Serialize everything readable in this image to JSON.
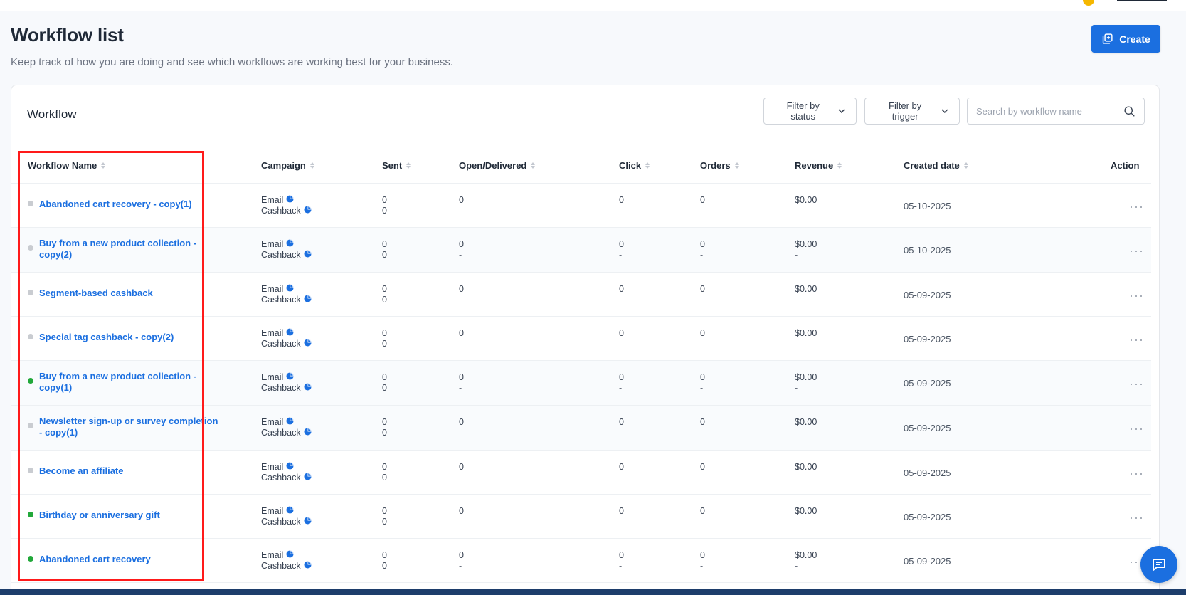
{
  "page": {
    "title": "Workflow list",
    "subtitle": "Keep track of how you are doing and see which workflows are working best for your business.",
    "create_label": "Create"
  },
  "card": {
    "title": "Workflow",
    "filter_status_label": "Filter by status",
    "filter_trigger_label": "Filter by trigger",
    "search_placeholder": "Search by workflow name"
  },
  "table": {
    "columns": [
      "Workflow Name",
      "Campaign",
      "Sent",
      "Open/Delivered",
      "Click",
      "Orders",
      "Revenue",
      "Created date",
      "Action"
    ],
    "campaign_email": "Email",
    "campaign_cashback": "Cashback",
    "rows": [
      {
        "name": "Abandoned cart recovery - copy(1)",
        "status": "inactive",
        "sent": [
          "0",
          "0"
        ],
        "open": [
          "0",
          "-"
        ],
        "click": [
          "0",
          "-"
        ],
        "orders": [
          "0",
          "-"
        ],
        "revenue": [
          "$0.00",
          "-"
        ],
        "created": "05-10-2025",
        "action": "···"
      },
      {
        "name": "Buy from a new product collection - copy(2)",
        "status": "inactive",
        "sent": [
          "0",
          "0"
        ],
        "open": [
          "0",
          "-"
        ],
        "click": [
          "0",
          "-"
        ],
        "orders": [
          "0",
          "-"
        ],
        "revenue": [
          "$0.00",
          "-"
        ],
        "created": "05-10-2025",
        "action": "···"
      },
      {
        "name": "Segment-based cashback",
        "status": "inactive",
        "sent": [
          "0",
          "0"
        ],
        "open": [
          "0",
          "-"
        ],
        "click": [
          "0",
          "-"
        ],
        "orders": [
          "0",
          "-"
        ],
        "revenue": [
          "$0.00",
          "-"
        ],
        "created": "05-09-2025",
        "action": "···"
      },
      {
        "name": "Special tag cashback - copy(2)",
        "status": "inactive",
        "sent": [
          "0",
          "0"
        ],
        "open": [
          "0",
          "-"
        ],
        "click": [
          "0",
          "-"
        ],
        "orders": [
          "0",
          "-"
        ],
        "revenue": [
          "$0.00",
          "-"
        ],
        "created": "05-09-2025",
        "action": "···"
      },
      {
        "name": "Buy from a new product collection - copy(1)",
        "status": "active",
        "sent": [
          "0",
          "0"
        ],
        "open": [
          "0",
          "-"
        ],
        "click": [
          "0",
          "-"
        ],
        "orders": [
          "0",
          "-"
        ],
        "revenue": [
          "$0.00",
          "-"
        ],
        "created": "05-09-2025",
        "action": "···"
      },
      {
        "name": "Newsletter sign-up or survey completion - copy(1)",
        "status": "inactive",
        "sent": [
          "0",
          "0"
        ],
        "open": [
          "0",
          "-"
        ],
        "click": [
          "0",
          "-"
        ],
        "orders": [
          "0",
          "-"
        ],
        "revenue": [
          "$0.00",
          "-"
        ],
        "created": "05-09-2025",
        "action": "···"
      },
      {
        "name": "Become an affiliate",
        "status": "inactive",
        "sent": [
          "0",
          "0"
        ],
        "open": [
          "0",
          "-"
        ],
        "click": [
          "0",
          "-"
        ],
        "orders": [
          "0",
          "-"
        ],
        "revenue": [
          "$0.00",
          "-"
        ],
        "created": "05-09-2025",
        "action": "···"
      },
      {
        "name": "Birthday or anniversary gift",
        "status": "active",
        "sent": [
          "0",
          "0"
        ],
        "open": [
          "0",
          "-"
        ],
        "click": [
          "0",
          "-"
        ],
        "orders": [
          "0",
          "-"
        ],
        "revenue": [
          "$0.00",
          "-"
        ],
        "created": "05-09-2025",
        "action": "···"
      },
      {
        "name": "Abandoned cart recovery",
        "status": "active",
        "sent": [
          "0",
          "0"
        ],
        "open": [
          "0",
          "-"
        ],
        "click": [
          "0",
          "-"
        ],
        "orders": [
          "0",
          "-"
        ],
        "revenue": [
          "$0.00",
          "-"
        ],
        "created": "05-09-2025",
        "action": "···"
      }
    ]
  },
  "colors": {
    "accent": "#1b6fe0",
    "status_active": "#22a83a",
    "status_inactive": "#c9ccd1",
    "highlight": "#ff1a1a"
  },
  "icons": {
    "create": "add-square-icon",
    "filter": "chevron-down-icon",
    "search": "search-icon",
    "campaign": "pie-chart-icon",
    "action": "more-horizontal-icon",
    "chat": "chat-icon"
  }
}
